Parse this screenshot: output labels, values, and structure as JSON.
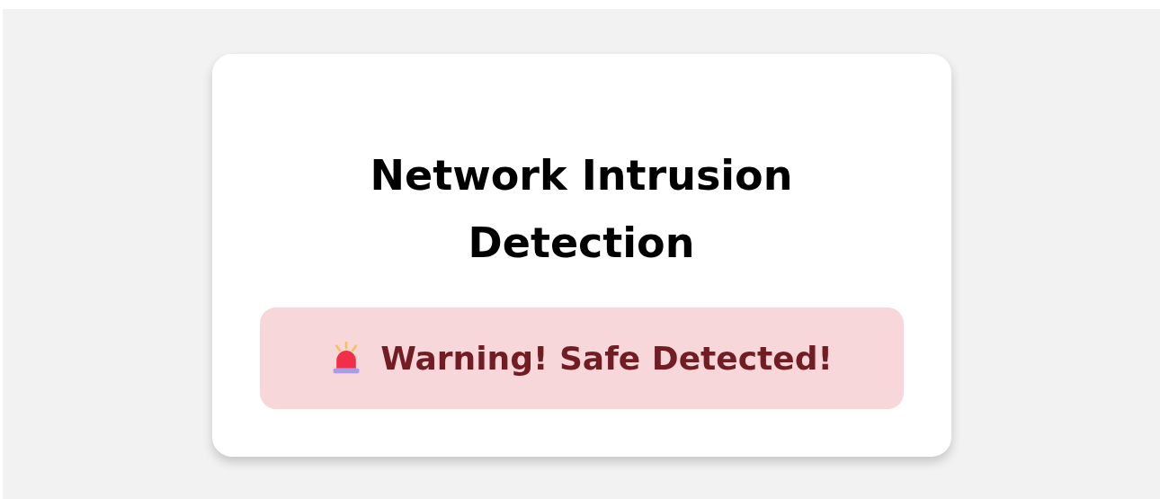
{
  "card": {
    "title": "Network Intrusion Detection",
    "alert": {
      "kind": "danger",
      "message": "Warning! Safe Detected!"
    }
  }
}
